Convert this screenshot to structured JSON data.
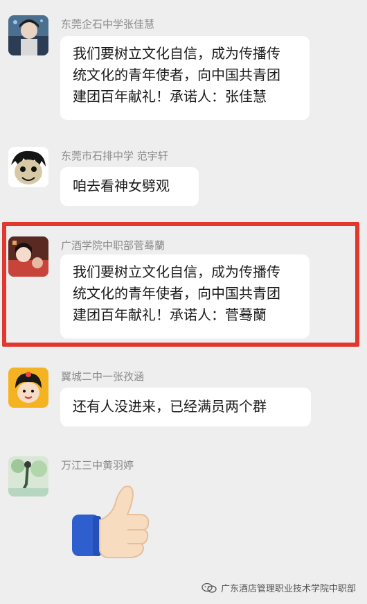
{
  "messages": [
    {
      "sender": "东莞企石中学张佳慧",
      "lines": [
        "我们要树立文化自信，成为传播传",
        "统文化的青年使者，向中国共青团",
        "建团百年献礼！承诺人：张佳慧"
      ]
    },
    {
      "sender": "东莞市石排中学 范宇轩",
      "lines": [
        "咱去看神女劈观"
      ]
    },
    {
      "sender": "广酒学院中职部菅蓦蘭",
      "lines": [
        "我们要树立文化自信，成为传播传",
        "统文化的青年使者，向中国共青团",
        "建团百年献礼！承诺人：菅蓦蘭"
      ]
    },
    {
      "sender": "翼城二中一张孜涵",
      "lines": [
        "还有人没进来，已经满员两个群"
      ]
    },
    {
      "sender": "万江三中黄羽婷",
      "sticker": "thumbs-up"
    }
  ],
  "watermark": {
    "text": "广东酒店管理职业技术学院中职部",
    "icon": "wechat-icon"
  }
}
